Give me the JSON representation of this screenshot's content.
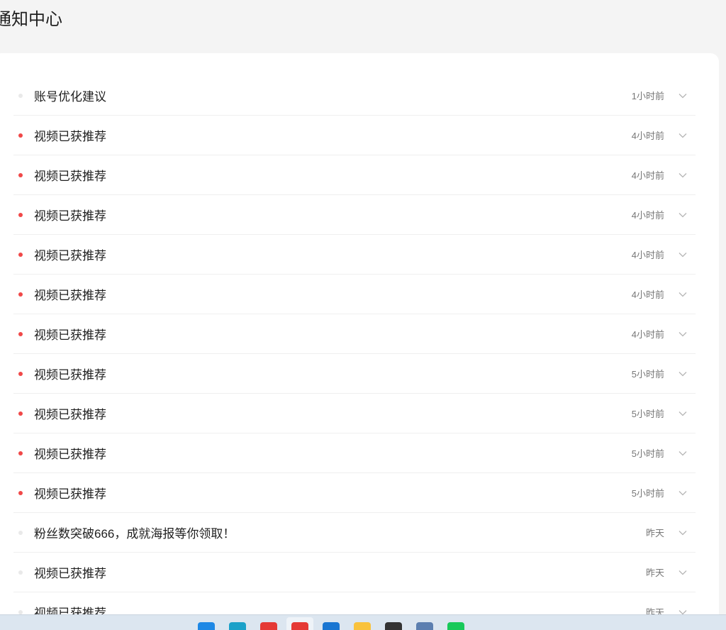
{
  "header": {
    "title": "通知中心"
  },
  "notifications": [
    {
      "title": "账号优化建议",
      "time": "1小时前",
      "unread": false
    },
    {
      "title": "视频已获推荐",
      "time": "4小时前",
      "unread": true
    },
    {
      "title": "视频已获推荐",
      "time": "4小时前",
      "unread": true
    },
    {
      "title": "视频已获推荐",
      "time": "4小时前",
      "unread": true
    },
    {
      "title": "视频已获推荐",
      "time": "4小时前",
      "unread": true
    },
    {
      "title": "视频已获推荐",
      "time": "4小时前",
      "unread": true
    },
    {
      "title": "视频已获推荐",
      "time": "4小时前",
      "unread": true
    },
    {
      "title": "视频已获推荐",
      "time": "5小时前",
      "unread": true
    },
    {
      "title": "视频已获推荐",
      "time": "5小时前",
      "unread": true
    },
    {
      "title": "视频已获推荐",
      "time": "5小时前",
      "unread": true
    },
    {
      "title": "视频已获推荐",
      "time": "5小时前",
      "unread": true
    },
    {
      "title": "粉丝数突破666，成就海报等你领取！",
      "time": "昨天",
      "unread": false
    },
    {
      "title": "视频已获推荐",
      "time": "昨天",
      "unread": false
    },
    {
      "title": "视频已获推荐",
      "time": "昨天",
      "unread": false
    }
  ],
  "colors": {
    "unread_dot": "#f04848",
    "read_dot": "#e9e9e9",
    "card_bg": "#ffffff",
    "page_bg": "#f4f4f4"
  },
  "taskbar": {
    "icons": [
      {
        "name": "windows-start-icon",
        "color": "#1e88e5"
      },
      {
        "name": "edge-browser-icon",
        "color": "#1ba1c9"
      },
      {
        "name": "wps-app-icon",
        "color": "#e53935"
      },
      {
        "name": "chrome-browser-icon",
        "color": "#e53935"
      },
      {
        "name": "vscode-icon",
        "color": "#1976d2"
      },
      {
        "name": "file-explorer-icon",
        "color": "#f9c23c"
      },
      {
        "name": "terminal-icon",
        "color": "#333333"
      },
      {
        "name": "remote-desktop-icon",
        "color": "#5c7fb0"
      },
      {
        "name": "wechat-icon",
        "color": "#18c95a"
      }
    ]
  }
}
